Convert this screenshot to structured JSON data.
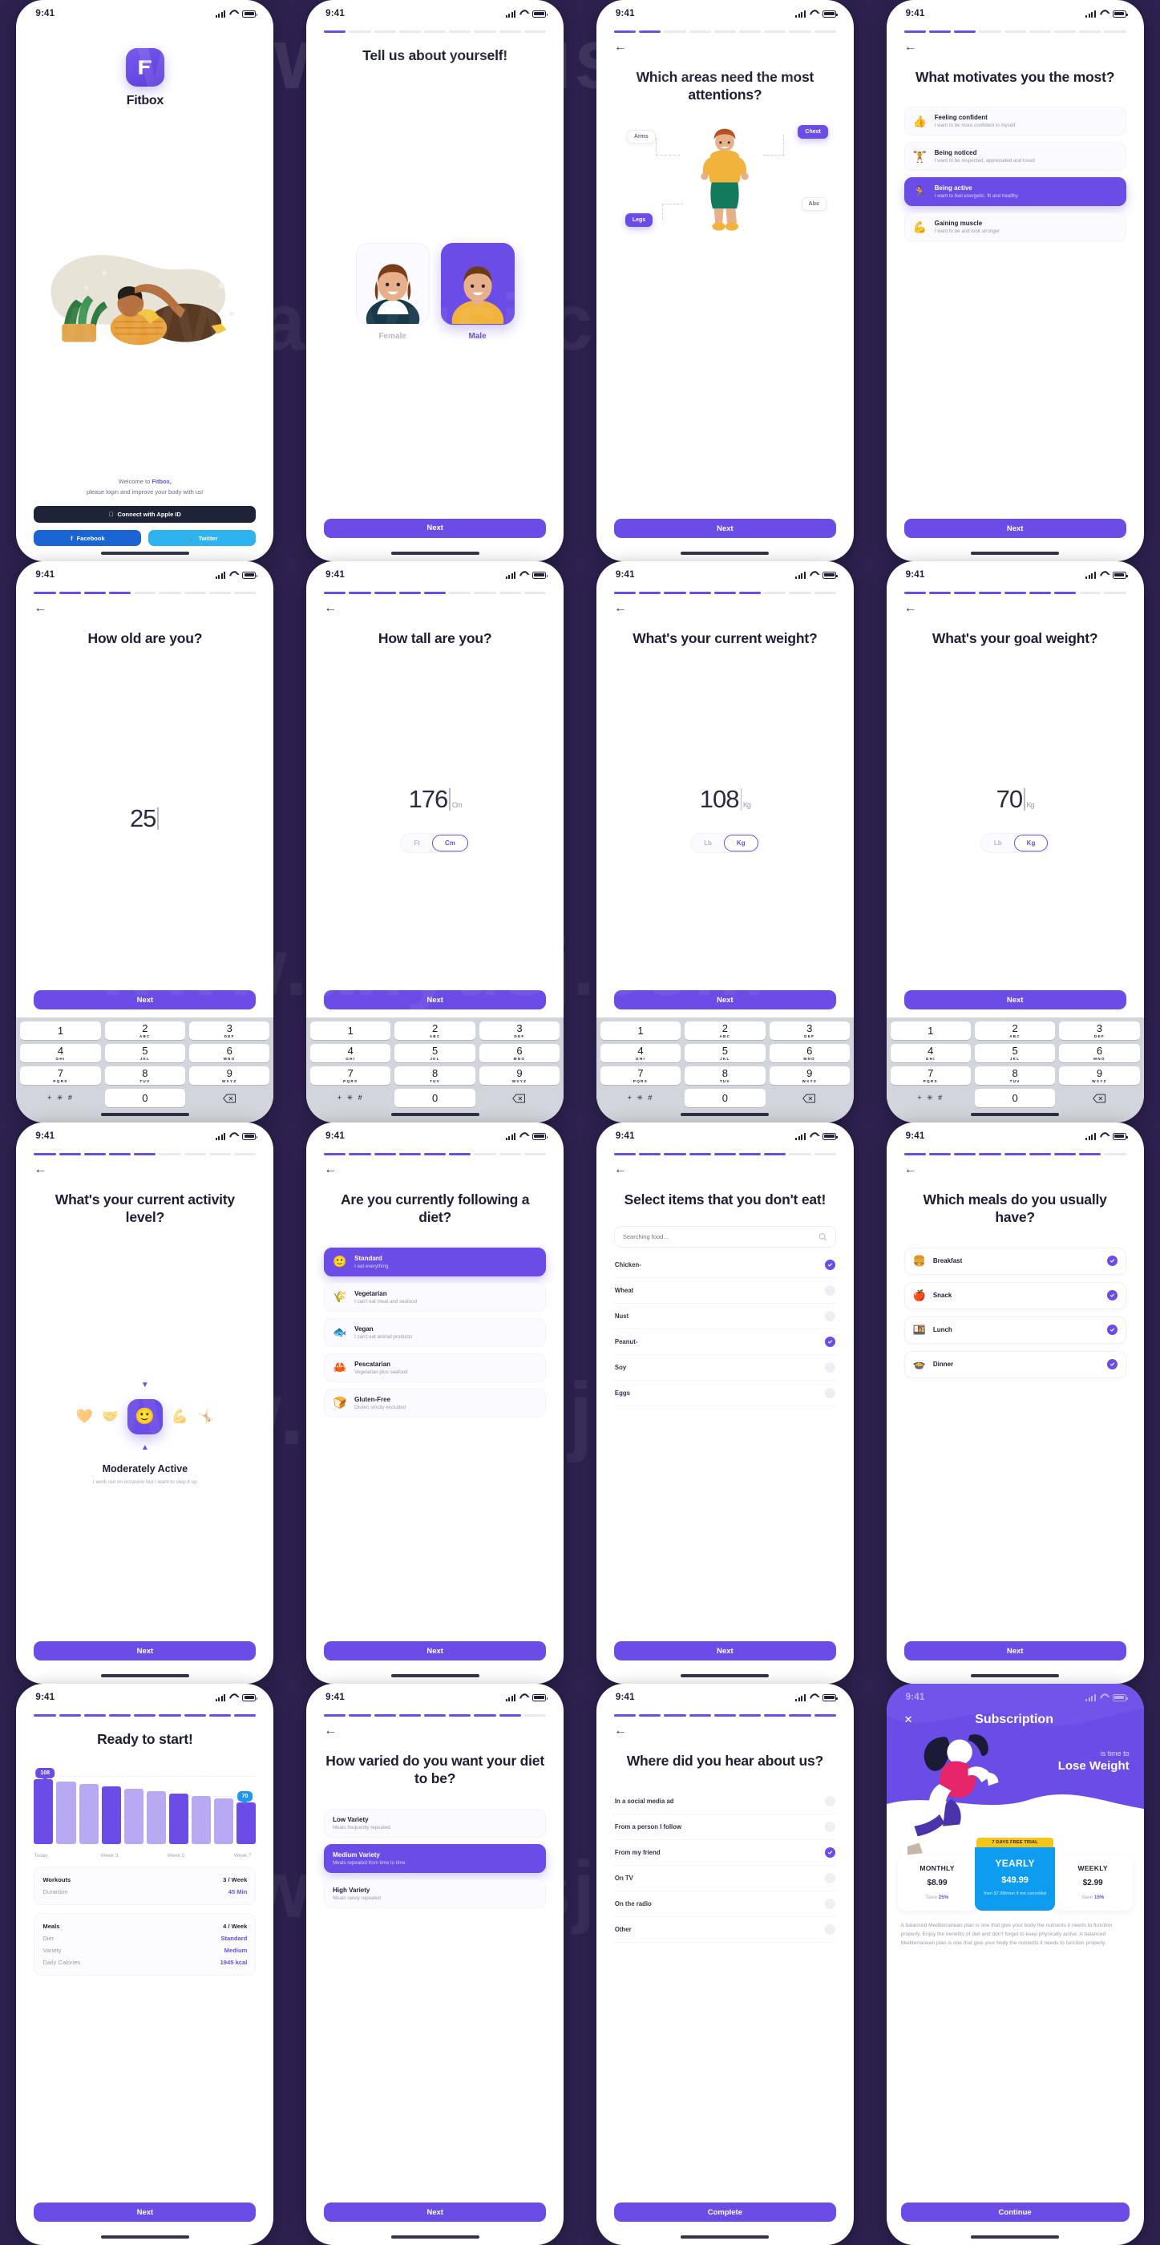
{
  "meta": {
    "status_time": "9:41",
    "background": "#2e2150",
    "accent": "#6b4ce6"
  },
  "watermark_text": "www.anyusj.com",
  "screens": {
    "welcome": {
      "brand": "Fitbox",
      "welcome_line1": "Welcome to ",
      "welcome_brand": "Fitbox,",
      "welcome_line2": "please login and improve your body with us!",
      "apple_btn": "Connect with Apple ID",
      "facebook_btn": "Facebook",
      "twitter_btn": "Twitter"
    },
    "gender": {
      "title": "Tell us about yourself!",
      "options": [
        {
          "label": "Female",
          "selected": false
        },
        {
          "label": "Male",
          "selected": true
        }
      ],
      "next": "Next"
    },
    "areas": {
      "title": "Which areas need the most attentions?",
      "tags": [
        {
          "label": "Arms",
          "selected": false
        },
        {
          "label": "Chest",
          "selected": true
        },
        {
          "label": "Abs",
          "selected": false
        },
        {
          "label": "Legs",
          "selected": true
        }
      ],
      "next": "Next"
    },
    "motivation": {
      "title": "What motivates you the most?",
      "options": [
        {
          "emoji": "👍",
          "title": "Feeling confident",
          "subtitle": "I want to be more confident in myself",
          "selected": false
        },
        {
          "emoji": "🏋",
          "title": "Being noticed",
          "subtitle": "I want to be respected, appreciated and loved",
          "selected": false
        },
        {
          "emoji": "🏃",
          "title": "Being active",
          "subtitle": "I want to feel energetic, fit and healthy",
          "selected": true
        },
        {
          "emoji": "💪",
          "title": "Gaining muscle",
          "subtitle": "I want to be and look stronger",
          "selected": false
        }
      ],
      "next": "Next"
    },
    "age": {
      "title": "How old are you?",
      "value": "25",
      "unit": "",
      "next": "Next"
    },
    "height": {
      "title": "How tall are you?",
      "value": "176",
      "unit": "Cm",
      "toggle": [
        {
          "label": "Ft",
          "on": false
        },
        {
          "label": "Cm",
          "on": true
        }
      ],
      "next": "Next"
    },
    "weight": {
      "title": "What's your current weight?",
      "value": "108",
      "unit": "Kg",
      "toggle": [
        {
          "label": "Lb",
          "on": false
        },
        {
          "label": "Kg",
          "on": true
        }
      ],
      "next": "Next"
    },
    "goal_weight": {
      "title": "What's your goal weight?",
      "value": "70",
      "unit": "Kg",
      "toggle": [
        {
          "label": "Lb",
          "on": false
        },
        {
          "label": "Kg",
          "on": true
        }
      ],
      "next": "Next"
    },
    "keypad": {
      "keys": [
        {
          "n": "1",
          "l": ""
        },
        {
          "n": "2",
          "l": "ABC"
        },
        {
          "n": "3",
          "l": "DEF"
        },
        {
          "n": "4",
          "l": "GHI"
        },
        {
          "n": "5",
          "l": "JKL"
        },
        {
          "n": "6",
          "l": "MNO"
        },
        {
          "n": "7",
          "l": "PQRS"
        },
        {
          "n": "8",
          "l": "TUV"
        },
        {
          "n": "9",
          "l": "WXYZ"
        }
      ],
      "symbols": "+ ✳ #",
      "zero": "0"
    },
    "activity": {
      "title": "What's your current activity level?",
      "selected_emoji": "🙂",
      "side_emojis": [
        "🧡",
        "🤝",
        "💪",
        "🤸"
      ],
      "name": "Moderately Active",
      "desc": "I work out on occasion but I want to step it up",
      "next": "Next"
    },
    "diet": {
      "title": "Are you currently following a diet?",
      "options": [
        {
          "emoji": "🙂",
          "title": "Standard",
          "subtitle": "I eat everything",
          "selected": true
        },
        {
          "emoji": "🌾",
          "title": "Vegetarian",
          "subtitle": "I can't eat meat and seafood",
          "selected": false
        },
        {
          "emoji": "🐟",
          "title": "Vegan",
          "subtitle": "I can't eat animal products",
          "selected": false
        },
        {
          "emoji": "🦀",
          "title": "Pescatarian",
          "subtitle": "Vegetarian plus seafood",
          "selected": false
        },
        {
          "emoji": "🍞",
          "title": "Gluten-Free",
          "subtitle": "Gluten strictly excluded",
          "selected": false
        }
      ],
      "next": "Next"
    },
    "exclude": {
      "title": "Select items that you don't eat!",
      "search_placeholder": "Searching food...",
      "items": [
        {
          "label": "Chicken-",
          "checked": true
        },
        {
          "label": "Wheat",
          "checked": false
        },
        {
          "label": "Nust",
          "checked": false
        },
        {
          "label": "Peanut-",
          "checked": true
        },
        {
          "label": "Soy",
          "checked": false
        },
        {
          "label": "Eggs",
          "checked": false
        }
      ],
      "next": "Next"
    },
    "meals": {
      "title": "Which meals do you usually have?",
      "items": [
        {
          "emoji": "🍔",
          "label": "Breakfast",
          "checked": true
        },
        {
          "emoji": "🍎",
          "label": "Snack",
          "checked": true
        },
        {
          "emoji": "🍱",
          "label": "Lunch",
          "checked": true
        },
        {
          "emoji": "🍲",
          "label": "Dinner",
          "checked": true
        }
      ],
      "next": "Next"
    },
    "ready": {
      "title": "Ready to start!",
      "stats_top": [
        {
          "key": "Workouts",
          "value": "3 / Week",
          "bold_key": true,
          "dark_value": true
        },
        {
          "key": "Durartion",
          "value": "45 Min",
          "bold_key": false,
          "dark_value": false
        }
      ],
      "stats_bottom": [
        {
          "key": "Meals",
          "value": "4 / Week",
          "bold_key": true,
          "dark_value": true
        },
        {
          "key": "Diet",
          "value": "Standard",
          "bold_key": false,
          "dark_value": false
        },
        {
          "key": "Variety",
          "value": "Medium",
          "bold_key": false,
          "dark_value": false
        },
        {
          "key": "Daily Calories",
          "value": "1945 kcal",
          "bold_key": false,
          "dark_value": false
        }
      ],
      "next": "Next"
    },
    "variety": {
      "title": "How varied do you want your diet to be?",
      "options": [
        {
          "title": "Low Variety",
          "subtitle": "Meals frequently repeated",
          "selected": false
        },
        {
          "title": "Medium Variety",
          "subtitle": "Meals repeated from time to time",
          "selected": true
        },
        {
          "title": "High Variety",
          "subtitle": "Meals rarely repeated",
          "selected": false
        }
      ],
      "next": "Next"
    },
    "hear": {
      "title": "Where did you hear about us?",
      "items": [
        {
          "label": "In a social media ad",
          "checked": false
        },
        {
          "label": "From a person I follow",
          "checked": false
        },
        {
          "label": "From my friend",
          "checked": true
        },
        {
          "label": "On TV",
          "checked": false
        },
        {
          "label": "On the radio",
          "checked": false
        },
        {
          "label": "Other",
          "checked": false
        }
      ],
      "complete": "Complete"
    },
    "subscription": {
      "title": "Subscription",
      "tagline_small": "is time to",
      "tagline_big": "Lose Weight",
      "trial_badge": "7 DAYS FREE TRIAL",
      "plans": [
        {
          "name": "MONTHLY",
          "price": "$8.99",
          "save_label": "Save ",
          "save_value": "25%",
          "featured": false,
          "note": ""
        },
        {
          "name": "YEARLY",
          "price": "$49.99",
          "save_label": "",
          "save_value": "",
          "featured": true,
          "note": "then $7.99/mon if not cancelled"
        },
        {
          "name": "WEEKLY",
          "price": "$2.99",
          "save_label": "Save ",
          "save_value": "15%",
          "featured": false,
          "note": ""
        }
      ],
      "description": "A balanced Mediterranean plan is one that give your body the nutrients it needs to function properly. Enjoy the benefits of diet and don't forget to keep physically active. A balanced Mediterranean plan is one that give your body the nutrients it needs to function properly.",
      "cta": "Continue"
    }
  },
  "chart_data": {
    "type": "bar",
    "title": "Ready to start!",
    "categories": [
      "Today",
      "",
      "",
      "Week 3",
      "",
      "",
      "Week 5",
      "",
      "",
      "Week 7"
    ],
    "values": [
      108,
      104,
      100,
      96,
      92,
      89,
      85,
      80,
      76,
      70
    ],
    "annotations": [
      {
        "label": "108",
        "index": 0,
        "color": "#6b4ce6"
      },
      {
        "label": "70",
        "index": 9,
        "color": "#2196f3"
      }
    ],
    "bar_colors": [
      "#6b4ce6",
      "#b9a9f2",
      "#b9a9f2",
      "#6b4ce6",
      "#b9a9f2",
      "#b9a9f2",
      "#6b4ce6",
      "#b9a9f2",
      "#b9a9f2",
      "#6b4ce6"
    ],
    "xlabel": "",
    "ylabel": "",
    "ylim": [
      0,
      120
    ],
    "grid": true,
    "legend": "none"
  }
}
